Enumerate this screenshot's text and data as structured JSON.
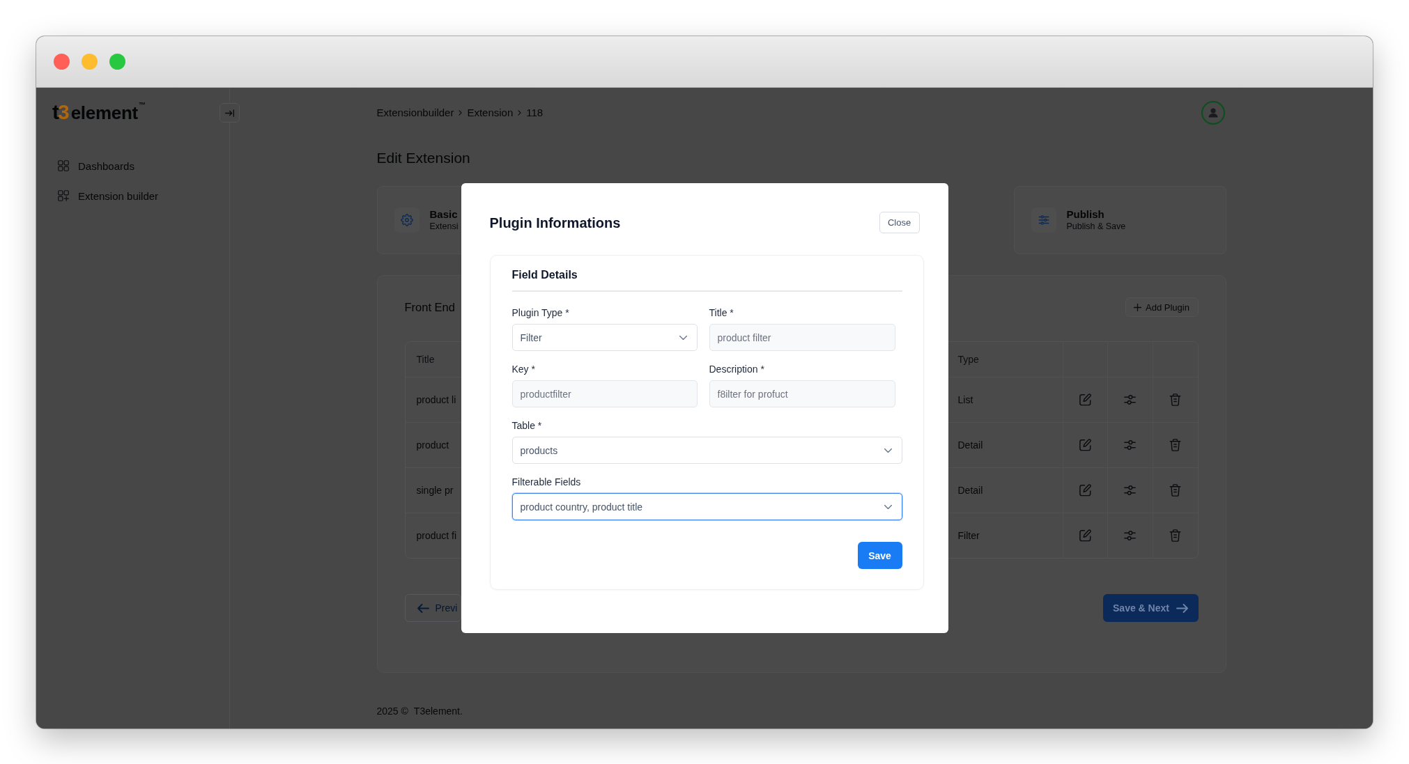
{
  "window_controls": [
    {
      "color": "#ff5f57"
    },
    {
      "color": "#febc2e"
    },
    {
      "color": "#28c840"
    }
  ],
  "sidebar": {
    "logo": {
      "mark": "t3",
      "name": "element",
      "trademark": "™"
    },
    "items": [
      {
        "label": "Dashboards",
        "kind": "dashboard",
        "selected": false
      },
      {
        "label": "Extension builder",
        "kind": "builder",
        "selected": false
      }
    ]
  },
  "header": {
    "breadcrumb": [
      "Extensionbuilder",
      "Extension",
      "118"
    ]
  },
  "page_title": "Edit Extension",
  "steps": [
    {
      "title": "Basic",
      "subtitle": "Extensi",
      "kind": "settings"
    },
    {
      "title": "Publish",
      "subtitle": "Publish & Save",
      "kind": "sliders"
    }
  ],
  "plugins": {
    "title": "Front End",
    "add_button": "Add Plugin",
    "columns": [
      "Title",
      "Type"
    ],
    "rows": [
      {
        "title": "product li",
        "type": "List"
      },
      {
        "title": "product",
        "type": "Detail"
      },
      {
        "title": "single pr",
        "type": "Detail"
      },
      {
        "title": "product fi",
        "type": "Filter"
      }
    ],
    "previous_button": "Previ",
    "next_button": "Save & Next"
  },
  "footer": {
    "copyright": "2025 ©",
    "link": "T3element."
  },
  "modal": {
    "title": "Plugin Informations",
    "close_button": "Close",
    "section_title": "Field Details",
    "rows": [
      [
        {
          "kind": "select",
          "label": "Plugin Type *",
          "value": "Filter",
          "disabled": false,
          "focused": false
        },
        {
          "kind": "input",
          "label": "Title *",
          "value": "product filter",
          "disabled": true,
          "focused": false
        }
      ],
      [
        {
          "kind": "input",
          "label": "Key *",
          "value": "productfilter",
          "disabled": true,
          "focused": false
        },
        {
          "kind": "input",
          "label": "Description *",
          "value": "f8ilter for profuct",
          "disabled": true,
          "focused": false
        }
      ],
      [
        {
          "kind": "select",
          "label": "Table *",
          "value": "products",
          "disabled": false,
          "focused": false
        }
      ],
      [
        {
          "kind": "select",
          "label": "Filterable Fields",
          "value": "product country, product title",
          "disabled": false,
          "focused": true
        }
      ]
    ],
    "save_button": "Save"
  }
}
